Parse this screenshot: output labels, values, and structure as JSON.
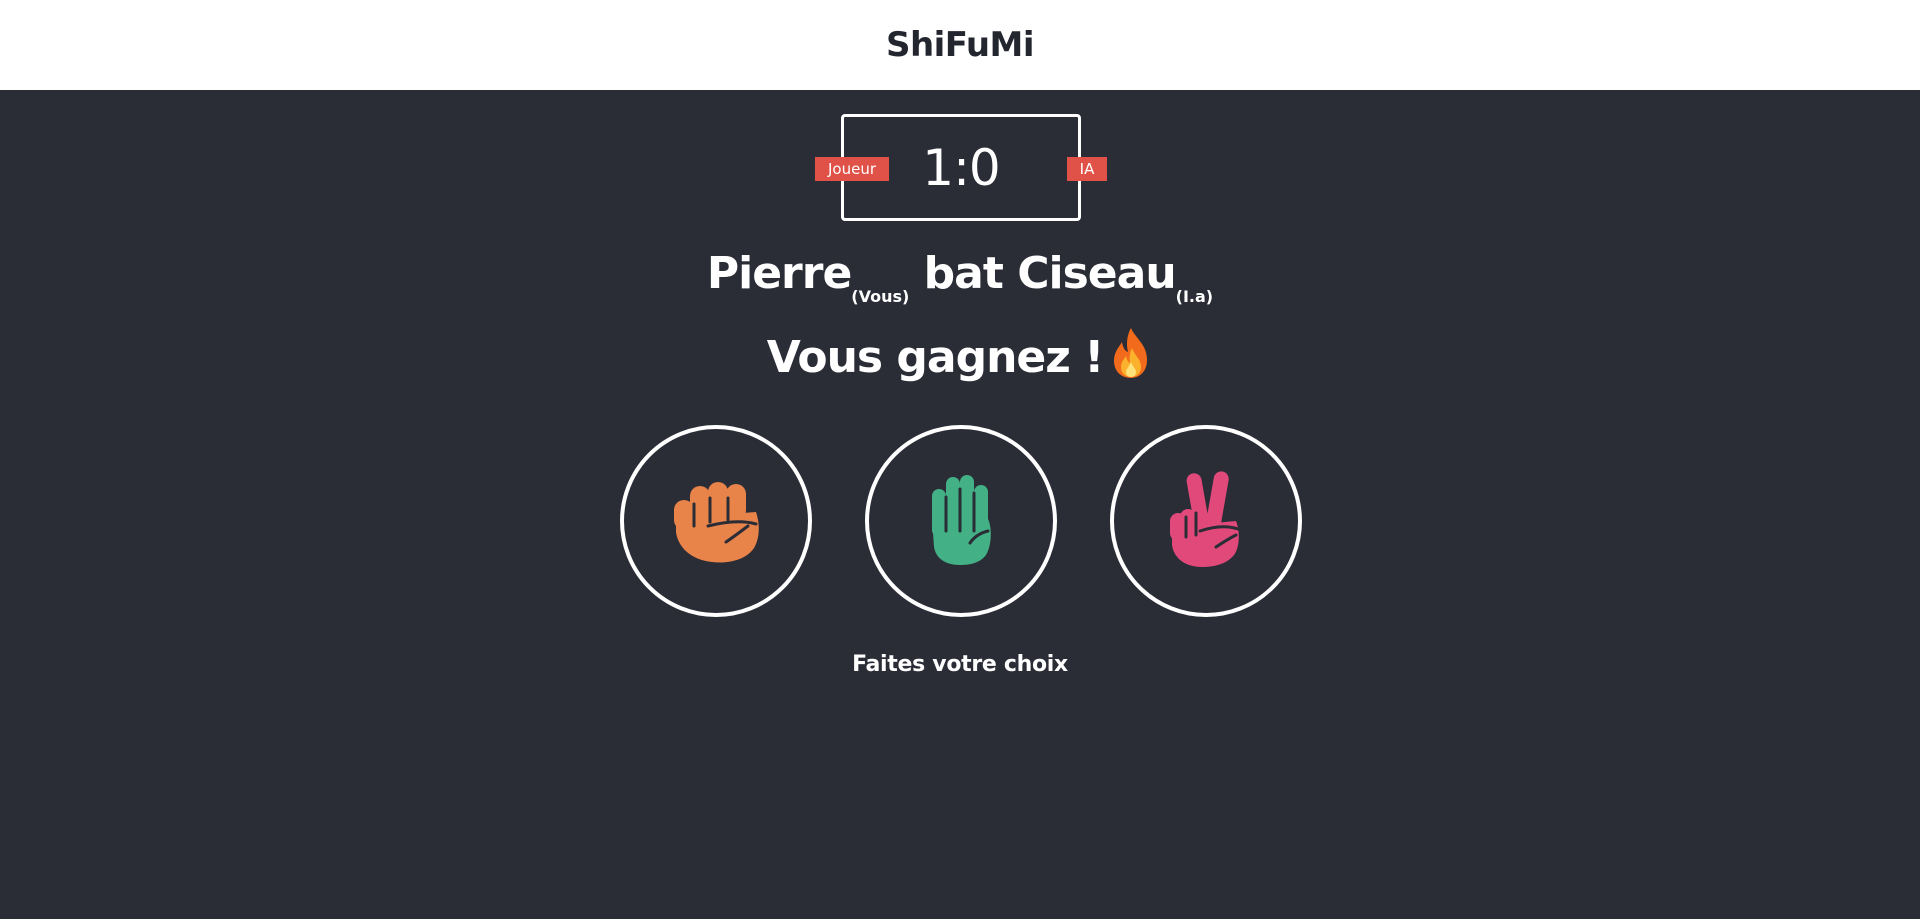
{
  "header": {
    "title": "ShiFuMi"
  },
  "scoreboard": {
    "player_label": "Joueur",
    "ai_label": "IA",
    "score": "1:0"
  },
  "result": {
    "player_choice": "Pierre",
    "player_tag": "(Vous)",
    "verb": "bat",
    "ai_choice": "Ciseau",
    "ai_tag": "(I.a)",
    "outcome": "Vous gagnez !",
    "outcome_icon": "fire-icon"
  },
  "choices": [
    {
      "name": "rock",
      "icon": "fist-icon",
      "color": "#e8834a"
    },
    {
      "name": "paper",
      "icon": "raised-hand-icon",
      "color": "#43b085"
    },
    {
      "name": "scissors",
      "icon": "victory-hand-icon",
      "color": "#e0497a"
    }
  ],
  "prompt": "Faites votre choix",
  "colors": {
    "background": "#2a2c36",
    "header_bg": "#ffffff",
    "badge": "#e05247",
    "text": "#ffffff"
  }
}
